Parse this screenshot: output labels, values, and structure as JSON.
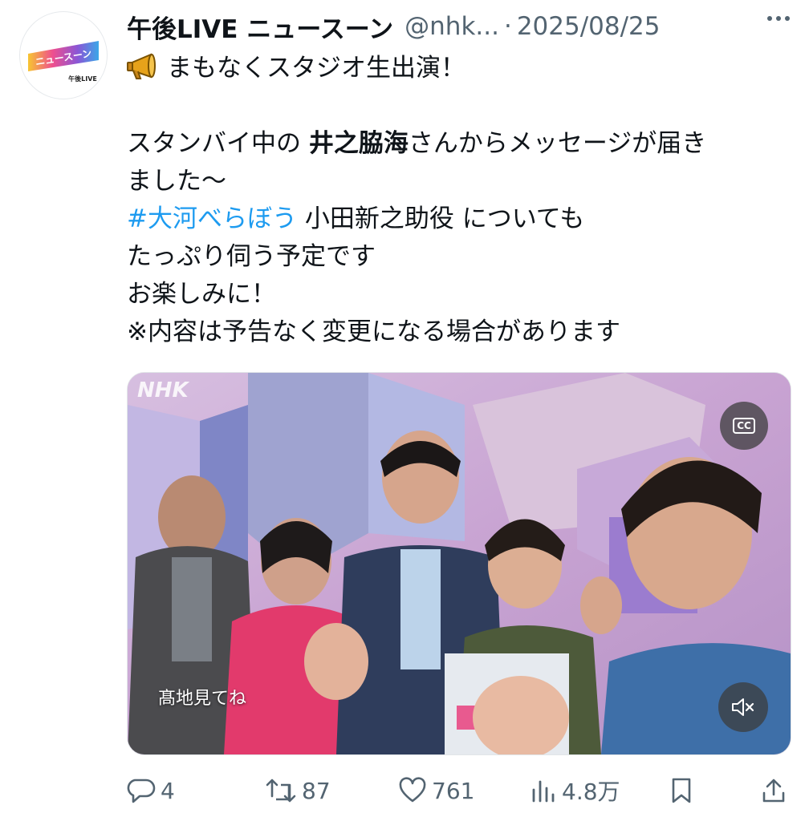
{
  "tweet": {
    "author_name": "午後LIVE ニュースーン",
    "handle": "@nhk...",
    "separator": "·",
    "date": "2025/08/25",
    "avatar_logo_text": "ニュースーン",
    "avatar_logo_sub": "午後LIVE",
    "text": {
      "line1": "まもなくスタジオ生出演！",
      "line2_pre": "スタンバイ中の ",
      "line2_bold": "井之脇海",
      "line2_post": "さんからメッセージが届き",
      "line3": "ました〜",
      "hashtag": "#大河べらぼう",
      "line4_post": " 小田新之助役 についても",
      "line5": "たっぷり伺う予定です",
      "line6": "お楽しみに！",
      "line7": "※内容は予告なく変更になる場合があります"
    }
  },
  "media": {
    "watermark": "NHK",
    "caption": "髙地見てね",
    "cc_label": "CC"
  },
  "actions": {
    "replies": "4",
    "reposts": "87",
    "likes": "761",
    "views": "4.8万"
  },
  "colors": {
    "text": "#0f1419",
    "secondary": "#536471",
    "link": "#1d9bf0"
  }
}
